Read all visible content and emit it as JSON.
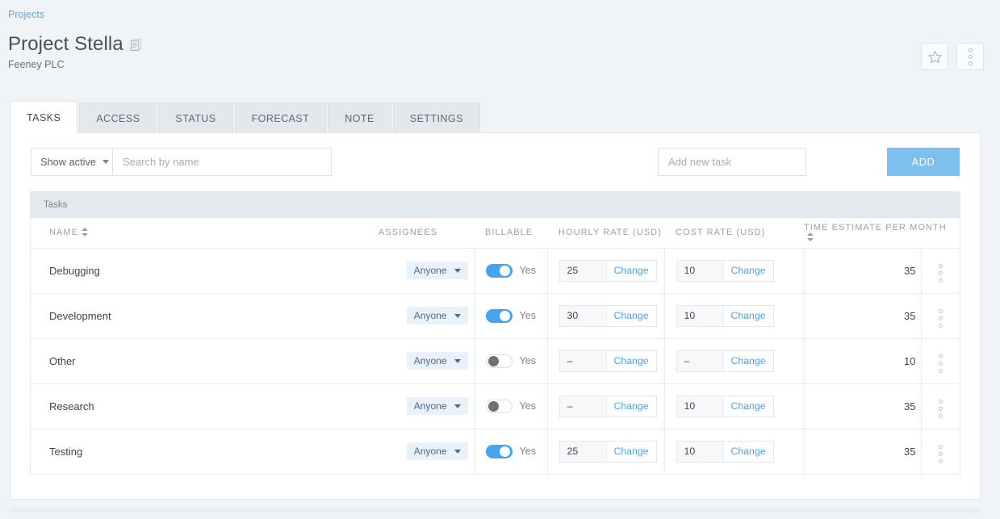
{
  "breadcrumb": {
    "label": "Projects"
  },
  "header": {
    "title": "Project Stella",
    "subtitle": "Feeney PLC",
    "copy_icon": "copy-document-icon",
    "favorite_icon": "star-outline-icon",
    "more_icon": "vertical-dots-icon"
  },
  "tabs": [
    {
      "label": "TASKS",
      "active": true
    },
    {
      "label": "ACCESS",
      "active": false
    },
    {
      "label": "STATUS",
      "active": false
    },
    {
      "label": "FORECAST",
      "active": false
    },
    {
      "label": "NOTE",
      "active": false
    },
    {
      "label": "SETTINGS",
      "active": false
    }
  ],
  "toolbar": {
    "filter_label": "Show active",
    "filter_caret_icon": "chevron-down-icon",
    "search_placeholder": "Search by name",
    "search_value": "",
    "new_task_placeholder": "Add new task",
    "new_task_value": "",
    "add_label": "ADD",
    "add_color": "#7cc0ef"
  },
  "table": {
    "caption": "Tasks",
    "columns": {
      "name": "NAME",
      "assignees": "ASSIGNEES",
      "billable": "BILLABLE",
      "hourly_rate": "HOURLY RATE (USD)",
      "cost_rate": "COST RATE (USD)",
      "time_estimate": "TIME ESTIMATE PER MONTH"
    },
    "sort_icon": "sort-arrows-icon",
    "change_label": "Change",
    "billable_yes_label": "Yes",
    "row_menu_icon": "vertical-dots-icon",
    "toggle_on_color": "#44a5ee",
    "toggle_off_color": "#6d7278",
    "link_color": "#4aa3e8",
    "rows": [
      {
        "name": "Debugging",
        "assignee": "Anyone",
        "billable_on": true,
        "billable_label": "Yes",
        "hourly_rate": "25",
        "cost_rate": "10",
        "time_estimate": "35"
      },
      {
        "name": "Development",
        "assignee": "Anyone",
        "billable_on": true,
        "billable_label": "Yes",
        "hourly_rate": "30",
        "cost_rate": "10",
        "time_estimate": "35"
      },
      {
        "name": "Other",
        "assignee": "Anyone",
        "billable_on": false,
        "billable_label": "Yes",
        "hourly_rate": "–",
        "cost_rate": "–",
        "time_estimate": "10"
      },
      {
        "name": "Research",
        "assignee": "Anyone",
        "billable_on": false,
        "billable_label": "Yes",
        "hourly_rate": "–",
        "cost_rate": "10",
        "time_estimate": "35"
      },
      {
        "name": "Testing",
        "assignee": "Anyone",
        "billable_on": true,
        "billable_label": "Yes",
        "hourly_rate": "25",
        "cost_rate": "10",
        "time_estimate": "35"
      }
    ]
  }
}
